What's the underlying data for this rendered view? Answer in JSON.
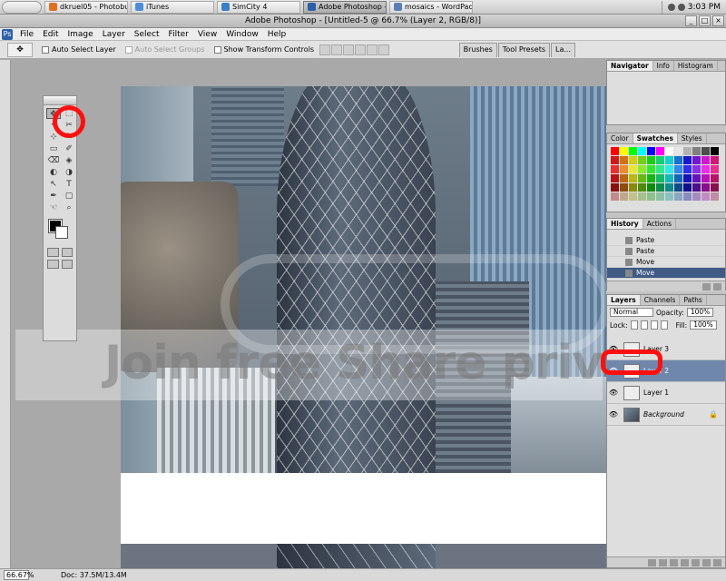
{
  "taskbar": {
    "tasks": [
      {
        "label": "dkruel05 - Photobuc...",
        "color": "#e07020"
      },
      {
        "label": "iTunes",
        "color": "#4a8fd8"
      },
      {
        "label": "SimCity 4",
        "color": "#3b7fc8"
      },
      {
        "label": "Adobe Photoshop - ...",
        "color": "#2d5fa8",
        "active": true
      },
      {
        "label": "mosaics - WordPad",
        "color": "#5a7fb8"
      }
    ],
    "clock": "3:03 PM"
  },
  "window": {
    "title": "Adobe Photoshop - [Untitled-5 @ 66.7% (Layer 2, RGB/8)]",
    "minimize": "_",
    "maximize": "□",
    "close": "×"
  },
  "menu": {
    "logo": "Ps",
    "items": [
      "File",
      "Edit",
      "Image",
      "Layer",
      "Select",
      "Filter",
      "View",
      "Window",
      "Help"
    ]
  },
  "options": {
    "tool_icon": "move-tool-icon",
    "tool_glyph": "✥",
    "auto_select_layer": "Auto Select Layer",
    "auto_select_groups": "Auto Select Groups",
    "show_transform_controls": "Show Transform Controls",
    "well_tabs": [
      "Brushes",
      "Tool Presets",
      "La..."
    ]
  },
  "toolbox": {
    "tools": [
      "✥",
      "⬚",
      "⌖",
      "✂",
      "⊹",
      "✎",
      "▭",
      "✐",
      "⌫",
      "◈",
      "◐",
      "◑",
      "↖",
      "T",
      "✒",
      "▢",
      "☜",
      "⌕"
    ],
    "selected_index": 0
  },
  "canvas": {
    "watermark": "Join free Share private",
    "bottom_white": true
  },
  "panels": {
    "navigator": {
      "tabs": [
        "Navigator",
        "Info",
        "Histogram"
      ]
    },
    "color": {
      "tabs": [
        "Color",
        "Swatches",
        "Styles"
      ],
      "active": "Swatches"
    },
    "history": {
      "tabs": [
        "History",
        "Actions"
      ],
      "rows": [
        "Paste",
        "Paste",
        "Move",
        "Move"
      ],
      "selected_index": 3
    },
    "layers": {
      "tabs": [
        "Layers",
        "Channels",
        "Paths"
      ],
      "blend_mode": "Normal",
      "opacity_label": "Opacity:",
      "opacity": "100%",
      "lock_label": "Lock:",
      "fill_label": "Fill:",
      "fill": "100%",
      "rows": [
        {
          "name": "Layer 3"
        },
        {
          "name": "Layer 2",
          "selected": true
        },
        {
          "name": "Layer 1"
        },
        {
          "name": "Background",
          "locked": true
        }
      ]
    }
  },
  "status": {
    "zoom": "66.67%",
    "doc": "Doc: 37.5M/13.4M"
  },
  "colors": {
    "highlight_red": "#ff1010",
    "selected_layer": "#6e87ab",
    "selected_history": "#3e5a85"
  }
}
